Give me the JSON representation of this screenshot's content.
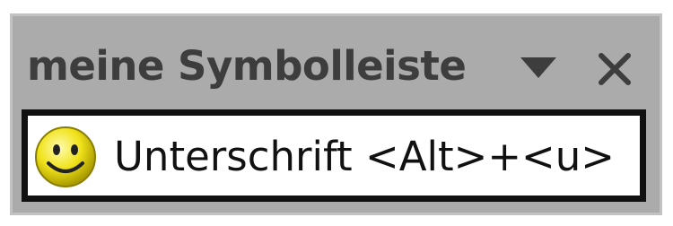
{
  "toolbar": {
    "title": "meine Symbolleiste",
    "buttons": [
      {
        "label": "Unterschrift <Alt>+<u>",
        "icon": "smiley-icon"
      }
    ]
  },
  "colors": {
    "title_bar": "#ababab",
    "title_text": "#3d3d3d",
    "body_border": "#111111",
    "body_background": "#ffffff",
    "smiley": "#e8e000"
  }
}
